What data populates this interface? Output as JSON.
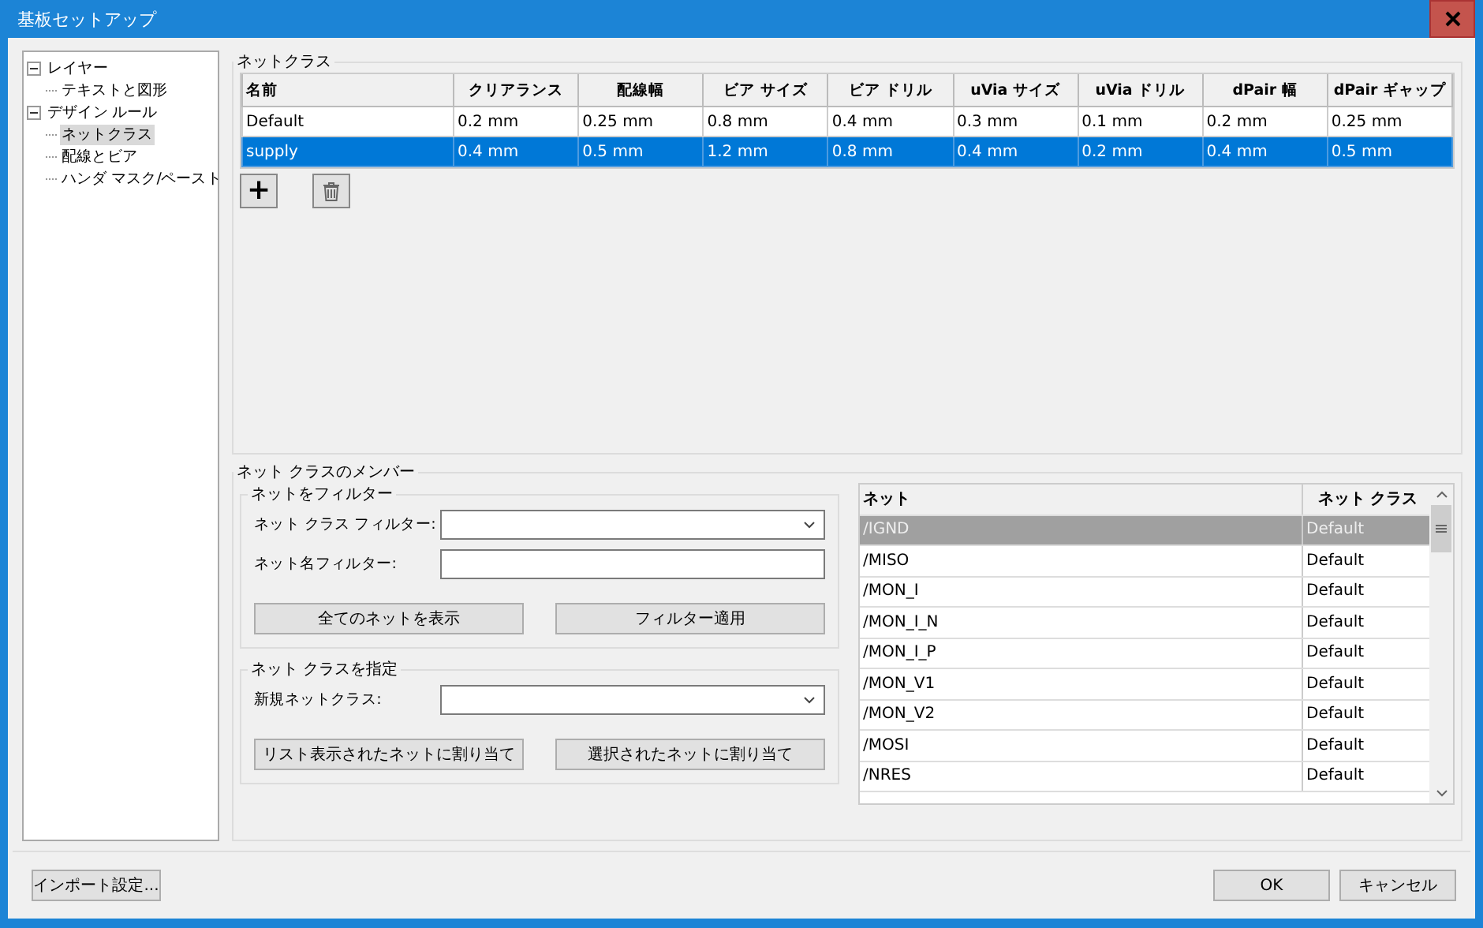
{
  "window": {
    "title": "基板セットアップ"
  },
  "tree": [
    {
      "label": "レイヤー",
      "expanded": true,
      "selected": false,
      "children": [
        {
          "label": "テキストと図形",
          "selected": false
        }
      ]
    },
    {
      "label": "デザイン ルール",
      "expanded": true,
      "selected": false,
      "children": [
        {
          "label": "ネットクラス",
          "selected": true
        },
        {
          "label": "配線とビア",
          "selected": false
        },
        {
          "label": "ハンダ マスク/ペースト",
          "selected": false
        }
      ]
    }
  ],
  "netclasses": {
    "title": "ネットクラス",
    "columns": [
      "名前",
      "クリアランス",
      "配線幅",
      "ビア サイズ",
      "ビア ドリル",
      "uVia サイズ",
      "uVia ドリル",
      "dPair 幅",
      "dPair ギャップ"
    ],
    "rows": [
      {
        "selected": false,
        "cells": [
          "Default",
          "0.2 mm",
          "0.25 mm",
          "0.8 mm",
          "0.4 mm",
          "0.3 mm",
          "0.1 mm",
          "0.2 mm",
          "0.25 mm"
        ]
      },
      {
        "selected": true,
        "cells": [
          "supply",
          "0.4 mm",
          "0.5 mm",
          "1.2 mm",
          "0.8 mm",
          "0.4 mm",
          "0.2 mm",
          "0.4 mm",
          "0.5 mm"
        ]
      }
    ],
    "add_button": "+"
  },
  "members": {
    "title": "ネット クラスのメンバー",
    "filter": {
      "title": "ネットをフィルター",
      "class_filter_label": "ネット クラス フィルター:",
      "name_filter_label": "ネット名フィルター:",
      "buttons": [
        "全てのネットを表示",
        "フィルター適用"
      ]
    },
    "assign": {
      "title": "ネット クラスを指定",
      "new_class_label": "新規ネットクラス:",
      "buttons": [
        "リスト表示されたネットに割り当て",
        "選択されたネットに割り当て"
      ]
    },
    "nets": {
      "columns": [
        "ネット",
        "ネット クラス"
      ],
      "rows": [
        {
          "net": "/IGND",
          "class": "Default",
          "selected": true
        },
        {
          "net": "/MISO",
          "class": "Default",
          "selected": false
        },
        {
          "net": "/MON_I",
          "class": "Default",
          "selected": false
        },
        {
          "net": "/MON_I_N",
          "class": "Default",
          "selected": false
        },
        {
          "net": "/MON_I_P",
          "class": "Default",
          "selected": false
        },
        {
          "net": "/MON_V1",
          "class": "Default",
          "selected": false
        },
        {
          "net": "/MON_V2",
          "class": "Default",
          "selected": false
        },
        {
          "net": "/MOSI",
          "class": "Default",
          "selected": false
        },
        {
          "net": "/NRES",
          "class": "Default",
          "selected": false
        }
      ]
    }
  },
  "footer": {
    "import_button": "インポート設定...",
    "ok_button": "OK",
    "cancel_button": "キャンセル"
  }
}
